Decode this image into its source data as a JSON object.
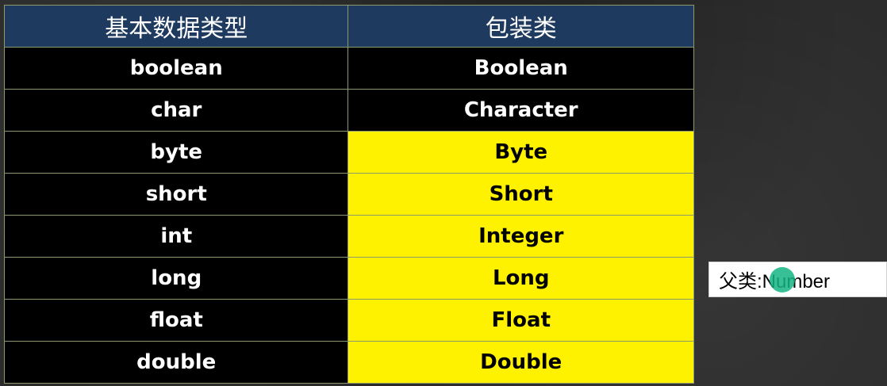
{
  "table": {
    "headers": {
      "primitive": "基本数据类型",
      "wrapper": "包装类"
    },
    "rows": [
      {
        "primitive": "boolean",
        "wrapper": "Boolean",
        "highlight": false
      },
      {
        "primitive": "char",
        "wrapper": "Character",
        "highlight": false
      },
      {
        "primitive": "byte",
        "wrapper": "Byte",
        "highlight": true
      },
      {
        "primitive": "short",
        "wrapper": "Short",
        "highlight": true
      },
      {
        "primitive": "int",
        "wrapper": "Integer",
        "highlight": true
      },
      {
        "primitive": "long",
        "wrapper": "Long",
        "highlight": true
      },
      {
        "primitive": "float",
        "wrapper": "Float",
        "highlight": true
      },
      {
        "primitive": "double",
        "wrapper": "Double",
        "highlight": true
      }
    ]
  },
  "note": {
    "text": "父类:Number"
  },
  "colors": {
    "header_bg": "#1f3a5f",
    "highlight_bg": "#fff200",
    "cell_bg": "#000000",
    "cursor": "#14b482"
  }
}
